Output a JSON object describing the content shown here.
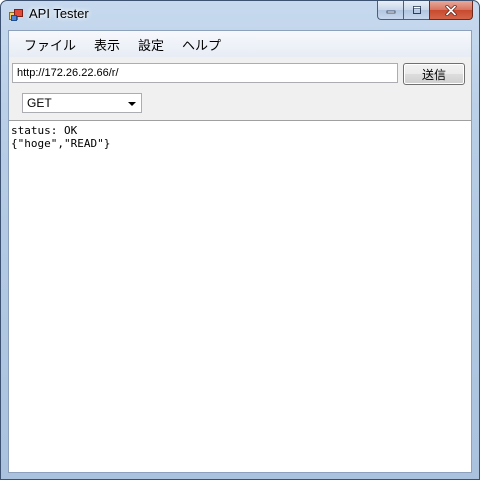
{
  "window": {
    "title": "API Tester",
    "icons": {
      "app": "app-window-icon",
      "minimize": "minimize-icon",
      "maximize": "maximize-icon",
      "close": "close-icon"
    }
  },
  "menu": {
    "items": [
      "ファイル",
      "表示",
      "設定",
      "ヘルプ"
    ]
  },
  "request": {
    "url": "http://172.26.22.66/r/",
    "send_label": "送信",
    "method": "GET"
  },
  "response": {
    "lines": [
      "status: OK",
      "{\"hoge\",\"READ\"}"
    ]
  },
  "colors": {
    "frame": "#b7cde6",
    "close_button": "#c74a2e",
    "client_background": "#f0f0f0"
  }
}
